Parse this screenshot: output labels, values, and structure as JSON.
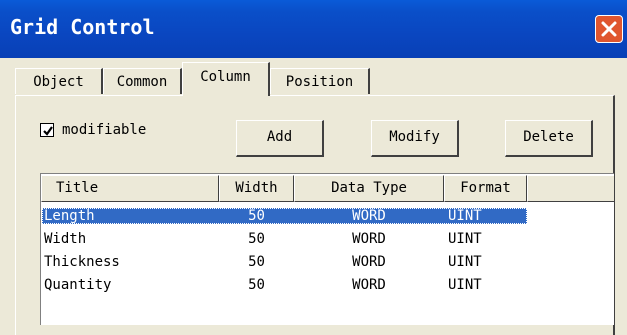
{
  "window": {
    "title": "Grid Control",
    "close_icon": "close-icon"
  },
  "tabs": [
    {
      "label": "Object"
    },
    {
      "label": "Common"
    },
    {
      "label": "Column"
    },
    {
      "label": "Position"
    }
  ],
  "options": {
    "modifiable_label": "modifiable",
    "modifiable_checked": true
  },
  "buttons": {
    "add": "Add",
    "modify": "Modify",
    "delete": "Delete"
  },
  "table": {
    "headers": [
      "Title",
      "Width",
      "Data Type",
      "Format"
    ],
    "rows": [
      [
        "Length",
        "50",
        "WORD",
        "UINT"
      ],
      [
        "Width",
        "50",
        "WORD",
        "UINT"
      ],
      [
        "Thickness",
        "50",
        "WORD",
        "UINT"
      ],
      [
        "Quantity",
        "50",
        "WORD",
        "UINT"
      ]
    ],
    "selected_row": 0
  },
  "colors": {
    "titlebar": "#0a4fc9",
    "selection": "#316ac5",
    "close": "#e0562f",
    "face": "#ece9d8"
  }
}
